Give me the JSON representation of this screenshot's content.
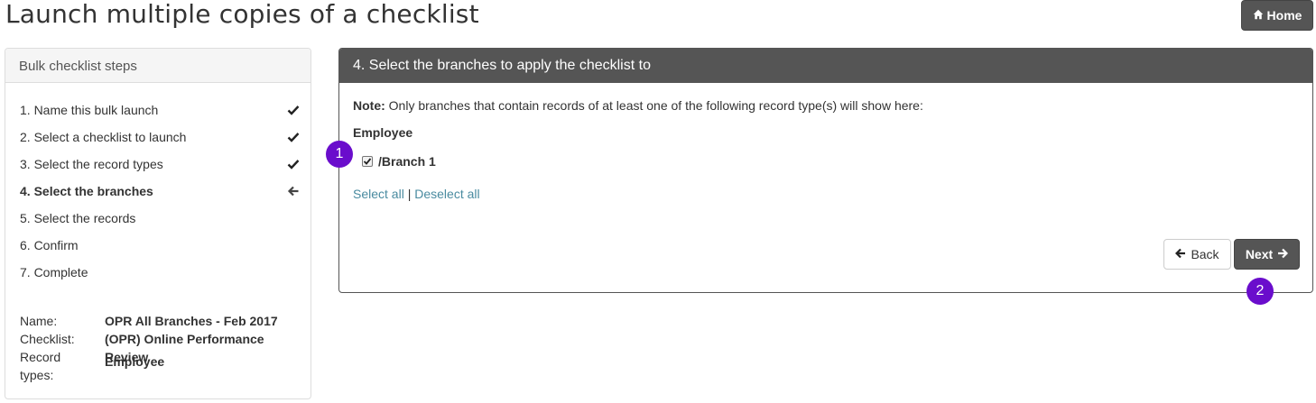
{
  "page": {
    "title": "Launch multiple copies of a checklist",
    "home_label": "Home"
  },
  "sidebar": {
    "header": "Bulk checklist steps",
    "steps": [
      {
        "label": "1. Name this bulk launch",
        "status": "done"
      },
      {
        "label": "2. Select a checklist to launch",
        "status": "done"
      },
      {
        "label": "3. Select the record types",
        "status": "done"
      },
      {
        "label": "4. Select the branches",
        "status": "current"
      },
      {
        "label": "5. Select the records",
        "status": "pending"
      },
      {
        "label": "6. Confirm",
        "status": "pending"
      },
      {
        "label": "7. Complete",
        "status": "pending"
      }
    ],
    "summary": {
      "name_label": "Name:",
      "name_value": "OPR All Branches - Feb 2017",
      "checklist_label": "Checklist:",
      "checklist_value": "(OPR) Online Performance Review",
      "record_types_label_1": "Record",
      "record_types_label_2": "types:",
      "record_types_value": "Employee"
    }
  },
  "panel": {
    "header": "4. Select the branches to apply the checklist to",
    "note_label": "Note:",
    "note_text": " Only branches that contain records of at least one of the following record type(s) will show here:",
    "record_type": "Employee",
    "branches": [
      {
        "label": "/Branch 1",
        "checked": true
      }
    ],
    "select_all": "Select all",
    "separator": " | ",
    "deselect_all": "Deselect all",
    "back_label": "Back",
    "next_label": "Next"
  },
  "badges": {
    "one": "1",
    "two": "2"
  },
  "colors": {
    "header_dark": "#555555",
    "link": "#4a8ba0",
    "badge": "#6a0dcc"
  },
  "icons": {
    "home": "home-icon",
    "done": "check-icon",
    "current": "arrow-left-icon",
    "back": "arrow-left-icon",
    "next": "arrow-right-icon"
  }
}
